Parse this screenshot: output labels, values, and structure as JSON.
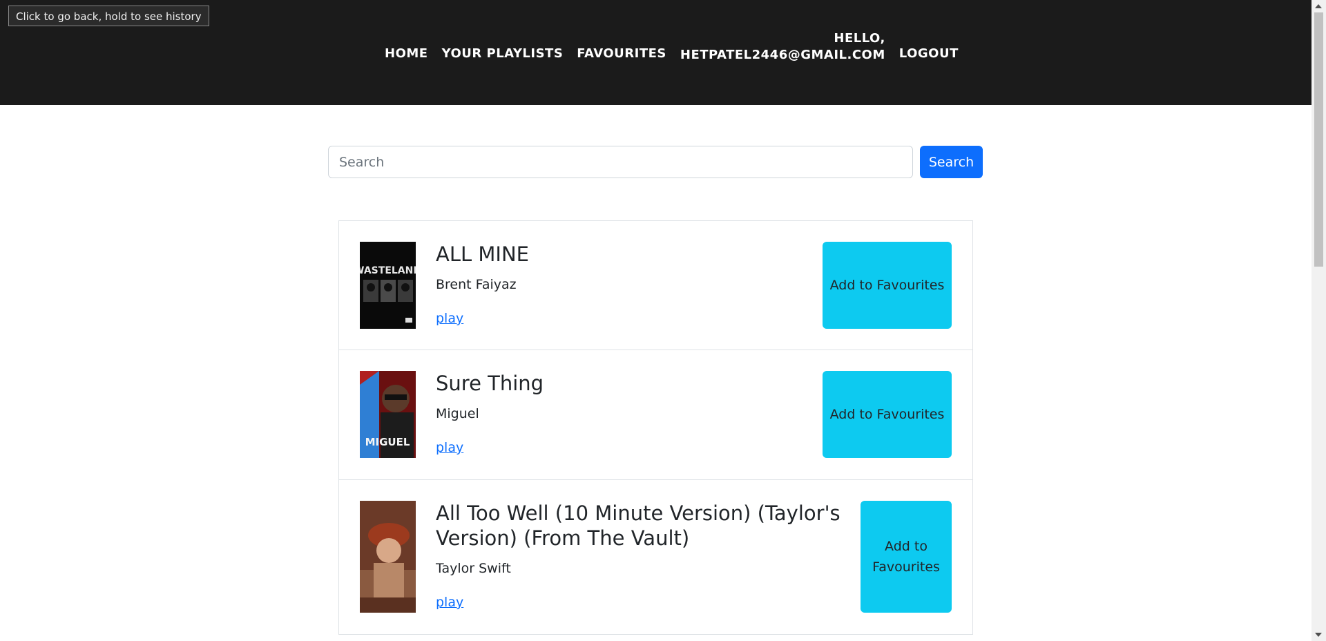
{
  "tooltip": "Click to go back, hold to see history",
  "nav": {
    "home": "HOME",
    "playlists": "YOUR PLAYLISTS",
    "favourites": "FAVOURITES",
    "hello": "HELLO,",
    "user_email": "HETPATEL2446@GMAIL.COM",
    "logout": "LOGOUT"
  },
  "search": {
    "placeholder": "Search",
    "value": "",
    "button_label": "Search"
  },
  "songs": [
    {
      "title": "ALL MINE",
      "artist": "Brent Faiyaz",
      "play_label": "play",
      "fav_label": "Add to Favourites",
      "cover_text": "WASTELAND"
    },
    {
      "title": "Sure Thing",
      "artist": "Miguel",
      "play_label": "play",
      "fav_label": "Add to Favourites",
      "cover_text": "MIGUEL"
    },
    {
      "title": "All Too Well (10 Minute Version) (Taylor's Version) (From The Vault)",
      "artist": "Taylor Swift",
      "play_label": "play",
      "fav_label": "Add to Favourites",
      "cover_text": ""
    }
  ],
  "colors": {
    "navbar_bg": "#1b1b1b",
    "primary": "#0d6efd",
    "info": "#0dcaf0"
  }
}
